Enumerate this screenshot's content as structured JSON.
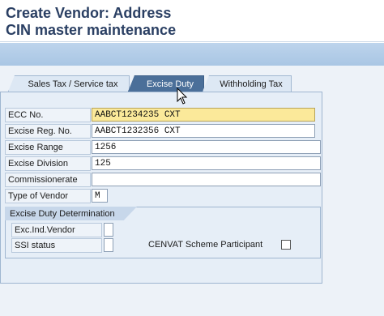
{
  "window": {
    "title_line1": "Create Vendor: Address",
    "title_line2": "CIN master maintenance"
  },
  "tabs": [
    {
      "label": "Sales Tax / Service tax",
      "active": false
    },
    {
      "label": "Excise Duty",
      "active": true
    },
    {
      "label": "Withholding Tax",
      "active": false
    }
  ],
  "form": {
    "ecc_no": {
      "label": "ECC No.",
      "value": "AABCT1234235 CXT"
    },
    "excise_reg_no": {
      "label": "Excise Reg. No.",
      "value": "AABCT1232356 CXT"
    },
    "excise_range": {
      "label": "Excise Range",
      "value": "1256"
    },
    "excise_division": {
      "label": "Excise Division",
      "value": "125"
    },
    "commissionerate": {
      "label": "Commissionerate",
      "value": ""
    },
    "type_of_vendor": {
      "label": "Type of Vendor",
      "value": "M"
    }
  },
  "group": {
    "title": "Excise Duty Determination",
    "exc_ind_vendor": {
      "label": "Exc.Ind.Vendor",
      "value": ""
    },
    "ssi_status": {
      "label": "SSI status",
      "value": ""
    },
    "cenvat": {
      "label": "CENVAT Scheme Participant",
      "checked": false
    }
  },
  "colors": {
    "title": "#2a3f63",
    "active_tab": "#4b6f99",
    "focus_field": "#fbe99a",
    "toolbar": "#bdd4ec"
  },
  "icons": {
    "cursor": "mouse-pointer-icon"
  }
}
